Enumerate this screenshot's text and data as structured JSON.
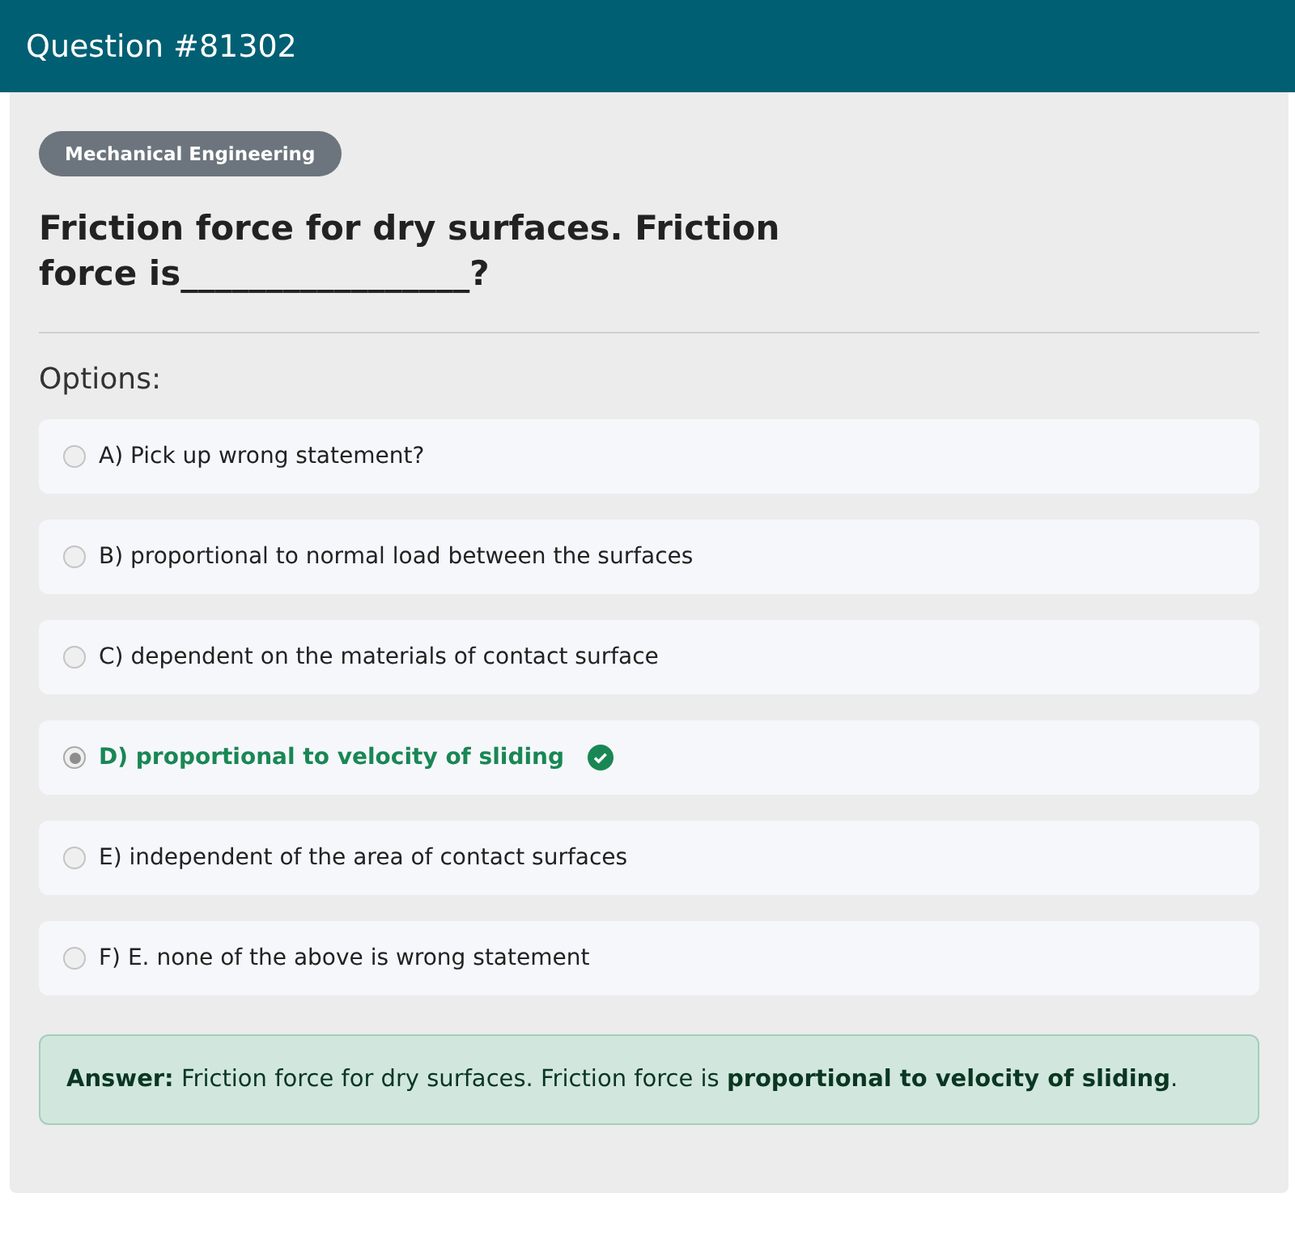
{
  "header": {
    "title": "Question #81302"
  },
  "category": "Mechanical Engineering",
  "question": "Friction force for dry surfaces. Friction force is_________________?",
  "options_label": "Options:",
  "options": [
    {
      "label": "A) Pick up wrong statement?",
      "selected": false,
      "correct": false
    },
    {
      "label": "B) proportional to normal load between the surfaces",
      "selected": false,
      "correct": false
    },
    {
      "label": "C) dependent on the materials of contact surface",
      "selected": false,
      "correct": false
    },
    {
      "label": "D) proportional to velocity of sliding",
      "selected": true,
      "correct": true
    },
    {
      "label": "E) independent of the area of contact surfaces",
      "selected": false,
      "correct": false
    },
    {
      "label": "F) E. none of the above is wrong statement",
      "selected": false,
      "correct": false
    }
  ],
  "answer": "**Answer:** Friction force for dry surfaces. Friction force is **proportional to velocity of sliding**."
}
